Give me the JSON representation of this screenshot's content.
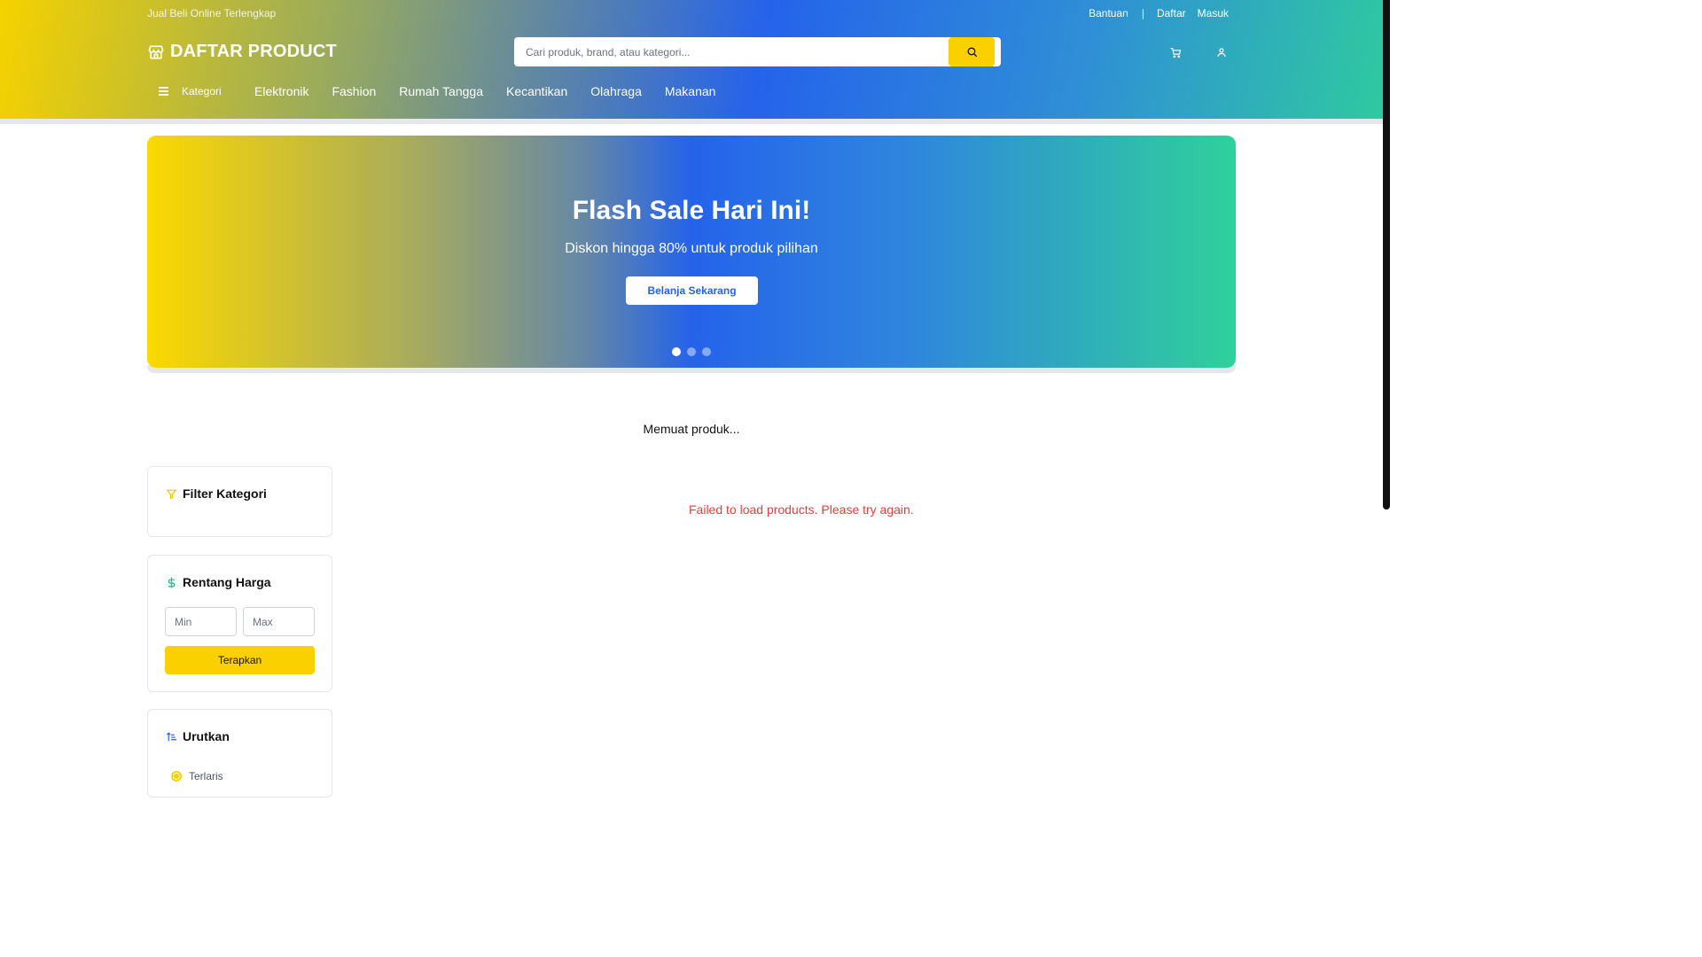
{
  "header": {
    "tagline": "Jual Beli Online Terlengkap",
    "links": {
      "help": "Bantuan",
      "separator": "|",
      "register": "Daftar",
      "login": "Masuk"
    },
    "brand": "DAFTAR PRODUCT",
    "search_placeholder": "Cari produk, brand, atau kategori...",
    "kategori_label": "Kategori",
    "categories": [
      "Elektronik",
      "Fashion",
      "Rumah Tangga",
      "Kecantikan",
      "Olahraga",
      "Makanan"
    ]
  },
  "banner": {
    "title": "Flash Sale Hari Ini!",
    "subtitle": "Diskon hingga 80% untuk produk pilihan",
    "cta": "Belanja Sekarang",
    "slides": 3,
    "active_slide": 1
  },
  "main": {
    "loading_text": "Memuat produk...",
    "error_text": "Failed to load products. Please try again."
  },
  "sidebar": {
    "filter_title": "Filter Kategori",
    "price_title": "Rentang Harga",
    "min_placeholder": "Min",
    "max_placeholder": "Max",
    "apply_label": "Terapkan",
    "sort_title": "Urutkan",
    "sort_options": [
      "Terlaris"
    ]
  },
  "colors": {
    "accent_yellow": "#fbd000",
    "primary_blue": "#2563eb",
    "teal": "#2fc9a0",
    "error_red": "#e53e3e"
  }
}
